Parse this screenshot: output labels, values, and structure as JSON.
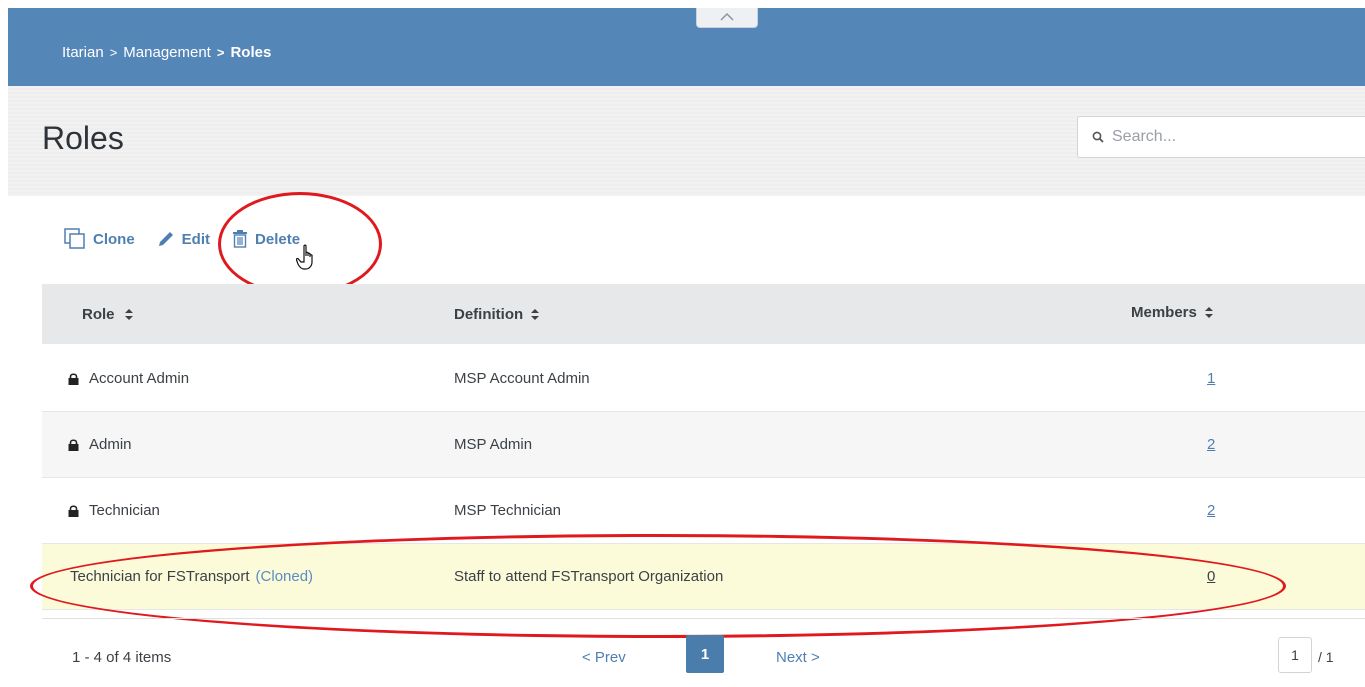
{
  "breadcrumb": {
    "items": [
      "Itarian",
      "Management",
      "Roles"
    ],
    "separator": ">"
  },
  "page": {
    "title": "Roles"
  },
  "search": {
    "placeholder": "Search..."
  },
  "toolbar": {
    "clone_label": "Clone",
    "edit_label": "Edit",
    "delete_label": "Delete"
  },
  "table": {
    "columns": [
      "Role",
      "Definition",
      "Members"
    ],
    "rows": [
      {
        "role": "Account Admin",
        "locked": true,
        "definition": "MSP Account Admin",
        "members": "1"
      },
      {
        "role": "Admin",
        "locked": true,
        "definition": "MSP Admin",
        "members": "2"
      },
      {
        "role": "Technician",
        "locked": true,
        "definition": "MSP Technician",
        "members": "2"
      },
      {
        "role": "Technician for FSTransport",
        "cloned_tag": "(Cloned)",
        "locked": false,
        "definition": "Staff to attend FSTransport Organization",
        "members": "0"
      }
    ]
  },
  "pager": {
    "summary": "1 - 4 of 4 items",
    "prev_label": "< Prev",
    "current_page": "1",
    "next_label": "Next >",
    "page_input": "1",
    "total_pages": "/ 1"
  },
  "colors": {
    "header_bg": "#5586b8",
    "accent": "#4f7fb1",
    "highlight_row": "#fbfbd9",
    "annotation": "#e0191e"
  }
}
